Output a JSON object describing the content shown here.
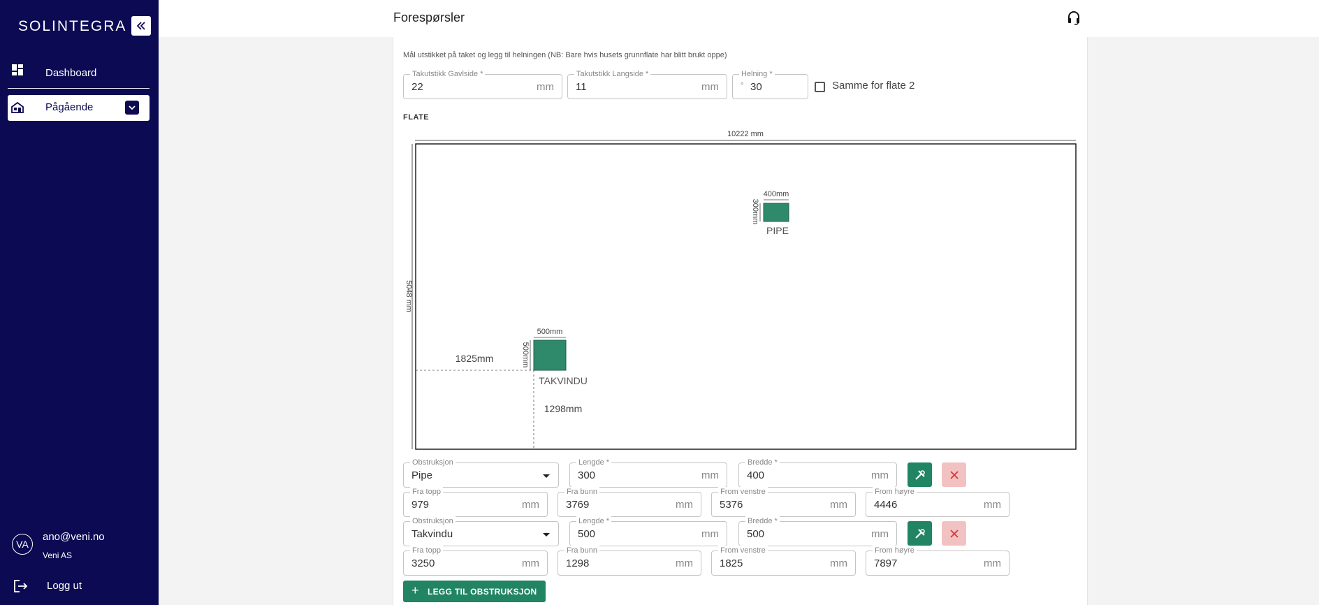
{
  "sidebar": {
    "logo": "SOLINTEGRA",
    "items": [
      {
        "label": "Dashboard",
        "icon": "dashboard-icon"
      },
      {
        "label": "Pågående",
        "icon": "house-icon"
      }
    ],
    "user": {
      "initials": "VA",
      "email": "ano@veni.no",
      "org": "Veni AS"
    },
    "logout_label": "Logg ut"
  },
  "header": {
    "title": "Forespørsler"
  },
  "main": {
    "info_text": "Mål utstikket på taket og legg til helningen (NB: Bare hvis husets grunnflate har blitt brukt oppe)",
    "roof_fields": [
      {
        "label": "Takutstikk Gavlside *",
        "value": "22",
        "unit": "mm"
      },
      {
        "label": "Takutstikk Langside *",
        "value": "11",
        "unit": "mm"
      },
      {
        "label": "Helning *",
        "value": "30",
        "prefix": "°"
      }
    ],
    "same_for_label": "Samme for flate 2",
    "section_label": "FLATE",
    "drawing": {
      "width_label": "10222 mm",
      "height_label": "5048 mm",
      "obstructions": [
        {
          "name": "PIPE",
          "w_label": "400mm",
          "h_label": "300mm"
        },
        {
          "name": "TAKVINDU",
          "w_label": "500mm",
          "h_label": "500mm",
          "left_label": "1825mm",
          "bottom_label": "1298mm"
        }
      ]
    },
    "obstructions": [
      {
        "type_label": "Obstruksjon",
        "type_value": "Pipe",
        "length_label": "Lengde *",
        "length": "300",
        "width_label": "Bredde *",
        "width": "400",
        "top_label": "Fra topp",
        "top": "979",
        "bottom_label": "Fra bunn",
        "bottom": "3769",
        "left_label": "From venstre",
        "left": "5376",
        "right_label": "From høyre",
        "right": "4446",
        "unit": "mm"
      },
      {
        "type_label": "Obstruksjon",
        "type_value": "Takvindu",
        "length_label": "Lengde *",
        "length": "500",
        "width_label": "Bredde *",
        "width": "500",
        "top_label": "Fra topp",
        "top": "3250",
        "bottom_label": "Fra bunn",
        "bottom": "1298",
        "left_label": "From venstre",
        "left": "1825",
        "right_label": "From høyre",
        "right": "7897",
        "unit": "mm"
      }
    ],
    "add_button_label": "LEGG TIL OBSTRUKSJON"
  },
  "colors": {
    "sidebar_bg": "#0b0a52",
    "accent_green": "#218463",
    "delete_red": "#f2c2c2"
  }
}
